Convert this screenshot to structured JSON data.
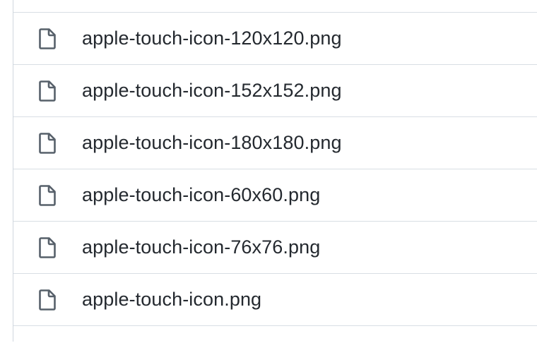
{
  "file_list": {
    "items": [
      {
        "icon": "file-icon",
        "name": "apple-touch-icon-120x120.png"
      },
      {
        "icon": "file-icon",
        "name": "apple-touch-icon-152x152.png"
      },
      {
        "icon": "file-icon",
        "name": "apple-touch-icon-180x180.png"
      },
      {
        "icon": "file-icon",
        "name": "apple-touch-icon-60x60.png"
      },
      {
        "icon": "file-icon",
        "name": "apple-touch-icon-76x76.png"
      },
      {
        "icon": "file-icon",
        "name": "apple-touch-icon.png"
      }
    ]
  },
  "colors": {
    "text": "#24292f",
    "icon": "#57606a",
    "border": "#d8dee4"
  }
}
